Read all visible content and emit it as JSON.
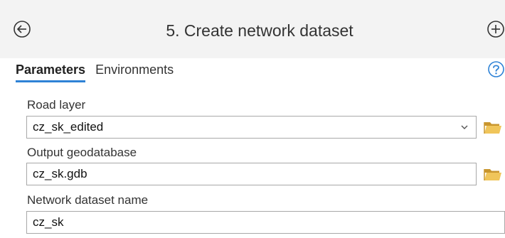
{
  "header": {
    "title": "5. Create network dataset",
    "back_icon": "arrow-left-circle-icon",
    "add_icon": "plus-circle-icon"
  },
  "tabs": [
    {
      "label": "Parameters",
      "active": true
    },
    {
      "label": "Environments",
      "active": false
    }
  ],
  "help_icon": "question-circle-icon",
  "params": {
    "road_layer": {
      "label": "Road layer",
      "value": "cz_sk_edited",
      "has_dropdown": true,
      "browse_icon": "folder-icon"
    },
    "output_gdb": {
      "label": "Output geodatabase",
      "value": "cz_sk.gdb",
      "browse_icon": "folder-icon"
    },
    "dataset_name": {
      "label": "Network dataset name",
      "value": "cz_sk"
    }
  },
  "colors": {
    "accent": "#2e82d6",
    "folder": "#e8b94a",
    "header_bg": "#f3f3f3"
  }
}
